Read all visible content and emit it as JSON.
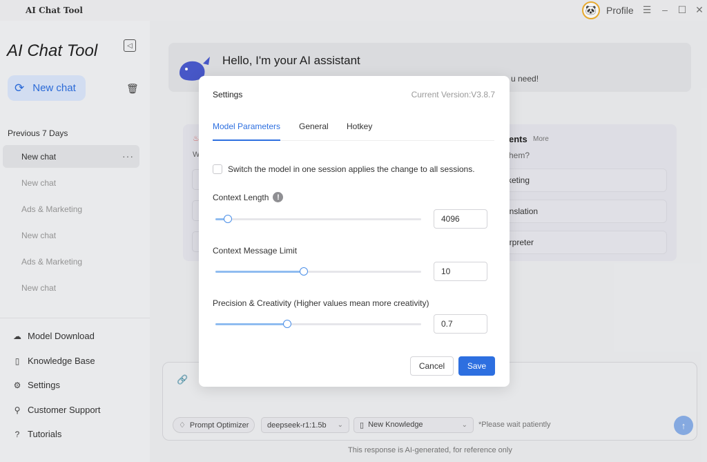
{
  "window": {
    "title": "AI Chat Tool",
    "profile_label": "Profile",
    "controls": [
      "menu-icon",
      "minimize-icon",
      "maximize-icon",
      "close-icon"
    ]
  },
  "sidebar": {
    "brand": "AI Chat Tool",
    "new_chat_label": "New chat",
    "section_label": "Previous 7 Days",
    "chats": [
      {
        "label": "New chat",
        "active": true
      },
      {
        "label": "New chat",
        "active": false
      },
      {
        "label": "Ads & Marketing",
        "active": false
      },
      {
        "label": "New chat",
        "active": false
      },
      {
        "label": "Ads & Marketing",
        "active": false
      },
      {
        "label": "New chat",
        "active": false
      }
    ],
    "more_label": "···",
    "nav": [
      {
        "label": "Model Download",
        "icon": "cloud-download-icon"
      },
      {
        "label": "Knowledge Base",
        "icon": "book-icon"
      },
      {
        "label": "Settings",
        "icon": "gear-icon"
      },
      {
        "label": "Customer Support",
        "icon": "user-icon"
      },
      {
        "label": "Tutorials",
        "icon": "help-circle-icon"
      }
    ]
  },
  "main": {
    "welcome_title": "Hello, I'm your AI assistant",
    "welcome_sub_visible": "u need!",
    "agents_title_visible": "ents",
    "agents_more": "More",
    "agents_sub_visible": "hem?",
    "agents_left_w": "W",
    "agent_items_visible": [
      "rketing",
      "anslation",
      "erpreter"
    ],
    "composer": {
      "prompt_optimizer": "Prompt Optimizer",
      "model_select": "deepseek-r1:1.5b",
      "knowledge_select": "New Knowledge",
      "wait_text": "*Please wait patiently"
    },
    "disclaimer": "This response is AI-generated, for reference only"
  },
  "settings_modal": {
    "title": "Settings",
    "version": "Current Version:V3.8.7",
    "tabs": [
      {
        "label": "Model Parameters",
        "active": true
      },
      {
        "label": "General",
        "active": false
      },
      {
        "label": "Hotkey",
        "active": false
      }
    ],
    "switch_model_label": "Switch the model in one session applies the change to all sessions.",
    "switch_model_checked": false,
    "fields": [
      {
        "label": "Context Length",
        "value": "4096",
        "slider_fraction": 0.06,
        "has_info": true
      },
      {
        "label": "Context Message Limit",
        "value": "10",
        "slider_fraction": 0.43,
        "has_info": false
      },
      {
        "label": "Precision & Creativity (Higher values mean more creativity)",
        "value": "0.7",
        "slider_fraction": 0.35,
        "has_info": false
      }
    ],
    "info_glyph": "!",
    "cancel_label": "Cancel",
    "save_label": "Save"
  },
  "colors": {
    "accent": "#2d6fe0",
    "slider_fill": "#8fbcf0",
    "new_chat_bg": "#dbe7fb"
  }
}
